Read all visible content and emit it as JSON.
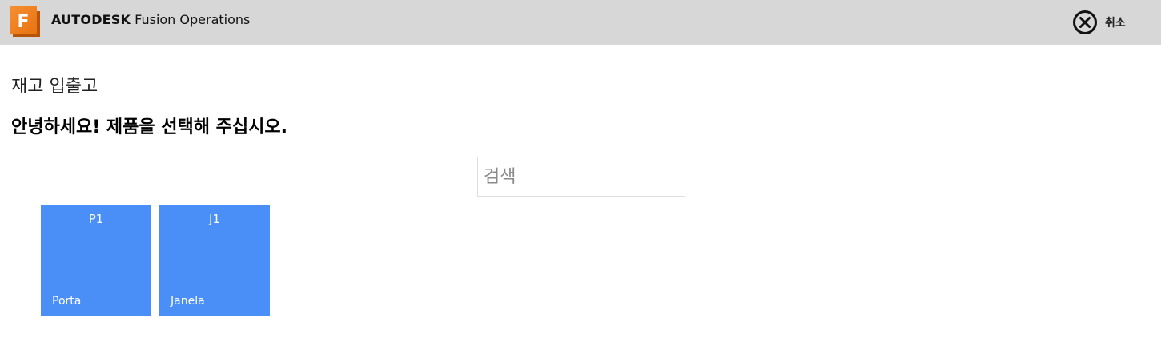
{
  "header": {
    "logo": {
      "icon": "fusion-f-logo-icon",
      "letter": "F",
      "color": "#f07d1a"
    },
    "brand_strong": "AUTODESK",
    "brand_rest": "Fusion Operations",
    "cancel": {
      "icon": "close-circle-icon",
      "label": "취소"
    }
  },
  "main": {
    "page_title": "재고 입출고",
    "greeting": "안녕하세요! 제품을 선택해 주십시오.",
    "search": {
      "placeholder": "검색",
      "value": ""
    },
    "tile_color": "#4a8ef8",
    "products": [
      {
        "code": "P1",
        "name": "Porta"
      },
      {
        "code": "J1",
        "name": "Janela"
      }
    ]
  }
}
